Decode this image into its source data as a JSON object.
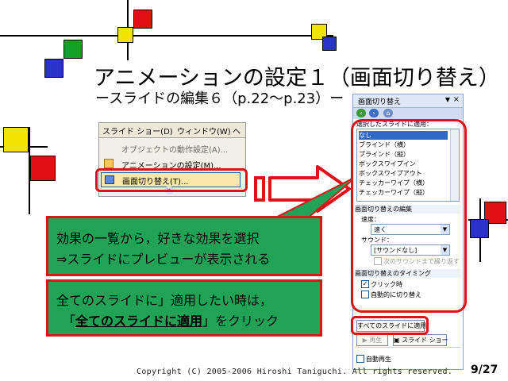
{
  "title": "アニメーションの設定１（画面切り替え）",
  "subtitle": "ースライドの編集６（p.22〜p.23）ー",
  "menu": {
    "bar_items": [
      "スライド ショー(D)",
      "ウィンドウ(W)",
      "ヘ"
    ],
    "items": [
      {
        "label": "オブジェクトの動作設定(A)...",
        "icon": "action-icon"
      },
      {
        "label": "アニメーションの設定(M)...",
        "icon": "animation-icon"
      },
      {
        "label": "画面切り替え(T)...",
        "icon": "transition-icon"
      }
    ],
    "expand_icon": "double-chevron-down-icon"
  },
  "task_pane": {
    "title": "画面切り替え",
    "close": "×",
    "apply_label": "選択したスライドに適用：",
    "effects": [
      "なし",
      "ブラインド（横）",
      "ブラインド（縦）",
      "ボックスワイプイン",
      "ボックスワイプアウト",
      "チェッカーワイプ（横）",
      "チェッカーワイプ（縦）"
    ],
    "edit_section": "画面切り替えの編集",
    "speed_label": "速度：",
    "speed_value": "速く",
    "sound_label": "サウンド：",
    "sound_value": "[サウンドなし]",
    "loop_label": "次のサウンドまで繰り返す",
    "timing_section": "画面切り替えのタイミング",
    "on_click_label": "クリック時",
    "on_click_checked": true,
    "auto_label": "自動的に切り替え",
    "auto_checked": false,
    "apply_all_button": "すべてのスライドに適用",
    "play_button": "再生",
    "slideshow_button": "スライド ショー",
    "autopreview_label": "自動再生",
    "autopreview_checked": false
  },
  "callout1": {
    "line1": "効果の一覧から，好きな効果を選択",
    "line2": "⇒スライドにプレビューが表示される"
  },
  "callout2": {
    "line1": "全てのスライドに」適用したい時は，",
    "line2_prefix": "「",
    "line2_bold": "全てのスライドに適用",
    "line2_suffix": "」をクリック"
  },
  "copyright": "Copyright (C) 2005-2006 Hiroshi Taniguchi. All rights reserved.",
  "page_number": "9/27",
  "colors": {
    "callout_bg": "#22a257",
    "highlight_red": "#e0101a",
    "square_red": "#e01010",
    "square_green": "#12a028",
    "square_blue": "#2a33c8",
    "square_yellow": "#f2e600"
  }
}
